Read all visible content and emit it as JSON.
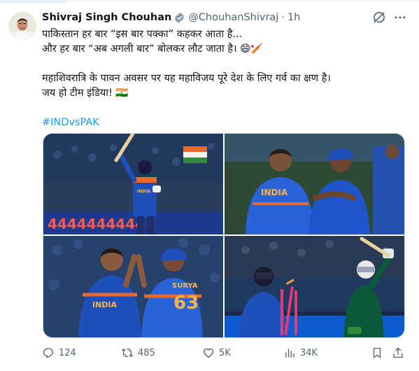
{
  "tweet": {
    "author_name": "Shivraj Singh Chouhan",
    "handle": "@ChouhanShivraj",
    "separator": "·",
    "time": "1h",
    "lines": [
      "पाकिस्तान हर बार “इस बार पक्का” कहकर आता है...",
      "और हर बार “अब अगली बार” बोलकर लौट जाता है। 😄🏏"
    ],
    "lines2": [
      "महाशिवरात्रि के पावन अवसर पर यह महाविजय पूरे देश के लिए गर्व का क्षण है।",
      "जय हो टीम इंडिया! 🇮🇳"
    ],
    "hashtag": "#INDvsPAK"
  },
  "media": {
    "jersey_text_1": "INDIA",
    "jersey_text_2": "INDIA",
    "jersey_name": "SURYA",
    "jersey_number": "63",
    "board_text": "4444444444"
  },
  "actions": {
    "replies": "124",
    "retweets": "485",
    "likes": "5K",
    "views": "34K"
  },
  "colors": {
    "accent": "#1d9bf0",
    "secondary_text": "#536471",
    "india_blue": "#1f4fb8",
    "pakistan_green": "#0b5a3a"
  },
  "icons": [
    "verified-badge-icon",
    "grok-icon",
    "more-icon",
    "reply-icon",
    "retweet-icon",
    "like-icon",
    "views-icon",
    "bookmark-icon",
    "share-icon"
  ]
}
